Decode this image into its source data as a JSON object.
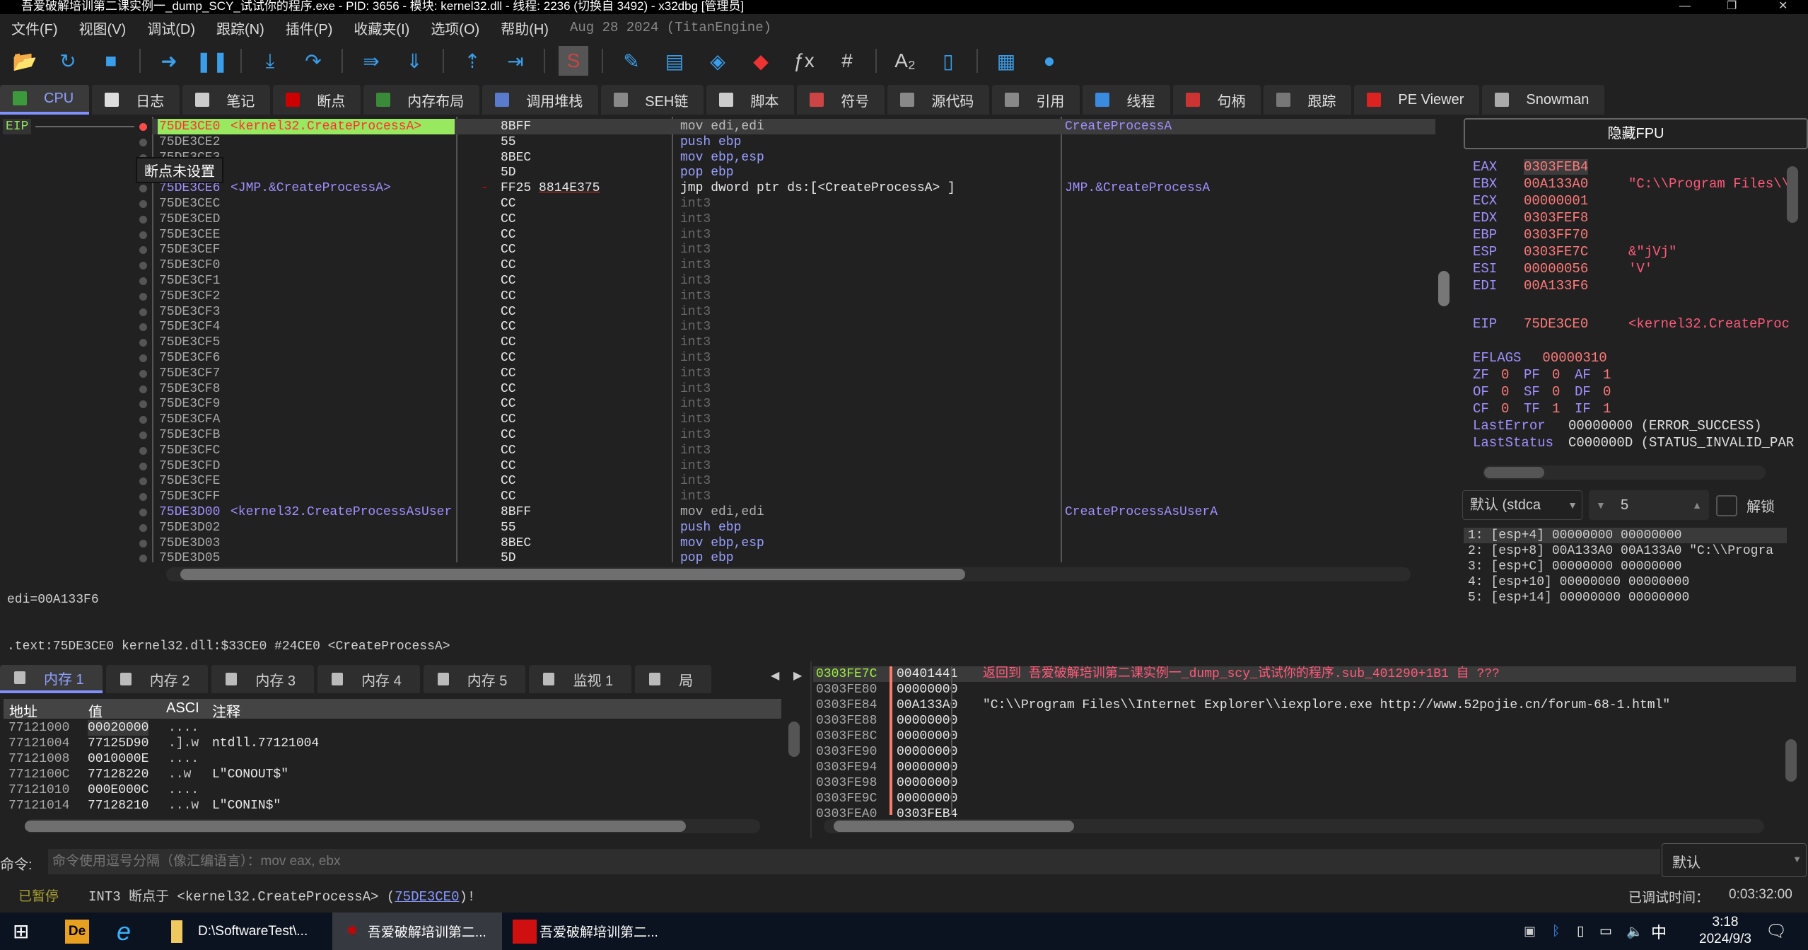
{
  "window": {
    "title": "吾爱破解培训第二课实例一_dump_SCY_试试你的程序.exe - PID: 3656 - 模块: kernel32.dll - 线程: 2236 (切换自 3492) - x32dbg [管理员]",
    "min": "—",
    "max": "❐",
    "close": "✕"
  },
  "menu": {
    "items": [
      "文件(F)",
      "视图(V)",
      "调试(D)",
      "跟踪(N)",
      "插件(P)",
      "收藏夹(I)",
      "选项(O)",
      "帮助(H)"
    ],
    "version": "Aug 28 2024 (TitanEngine)"
  },
  "toolbar": [
    {
      "icon": "open-icon",
      "g": "📂"
    },
    {
      "icon": "restart-icon",
      "g": "↻"
    },
    {
      "icon": "stop-icon",
      "g": "■"
    },
    {
      "sep": true
    },
    {
      "icon": "run-icon",
      "g": "➜"
    },
    {
      "icon": "pause-icon",
      "g": "❚❚"
    },
    {
      "sep": true
    },
    {
      "icon": "step-into-icon",
      "g": "⤓"
    },
    {
      "icon": "step-over-icon",
      "g": "↷"
    },
    {
      "sep": true
    },
    {
      "icon": "trace-into-icon",
      "g": "⇛"
    },
    {
      "icon": "trace-over-icon",
      "g": "⇓"
    },
    {
      "sep": true
    },
    {
      "icon": "execute-till-return-icon",
      "g": "⇡"
    },
    {
      "icon": "run-to-user-code-icon",
      "g": "⇥"
    },
    {
      "sep": true
    },
    {
      "icon": "scylla-icon",
      "g": "S"
    },
    {
      "sep": true
    },
    {
      "icon": "patch-icon",
      "g": "✎"
    },
    {
      "icon": "comments-icon",
      "g": "▤"
    },
    {
      "icon": "labels-icon",
      "g": "◈"
    },
    {
      "icon": "bookmarks-icon",
      "g": "◆"
    },
    {
      "icon": "functions-icon",
      "g": "ƒx"
    },
    {
      "icon": "hash-icon",
      "g": "#"
    },
    {
      "sep": true
    },
    {
      "icon": "strings-icon",
      "g": "A₂"
    },
    {
      "icon": "calls-icon",
      "g": "▯"
    },
    {
      "sep": true
    },
    {
      "icon": "calculator-icon",
      "g": "▦"
    },
    {
      "icon": "globe-icon",
      "g": "●"
    }
  ],
  "tabs": [
    {
      "label": "CPU",
      "color": "#3c9a3c",
      "active": true
    },
    {
      "label": "日志",
      "color": "#ddd"
    },
    {
      "label": "笔记",
      "color": "#ccc"
    },
    {
      "label": "断点",
      "color": "#c00"
    },
    {
      "label": "内存布局",
      "color": "#3a8a3a"
    },
    {
      "label": "调用堆栈",
      "color": "#5a7acc"
    },
    {
      "label": "SEH链",
      "color": "#888"
    },
    {
      "label": "脚本",
      "color": "#ccc"
    },
    {
      "label": "符号",
      "color": "#c44"
    },
    {
      "label": "源代码",
      "color": "#888"
    },
    {
      "label": "引用",
      "color": "#888"
    },
    {
      "label": "线程",
      "color": "#3a8ae0"
    },
    {
      "label": "句柄",
      "color": "#c33"
    },
    {
      "label": "跟踪",
      "color": "#777"
    },
    {
      "label": "PE Viewer",
      "color": "#d22"
    },
    {
      "label": "Snowman",
      "color": "#aaa"
    }
  ],
  "disasm": {
    "eip_label": "EIP",
    "tooltip": "断点未设置",
    "rows": [
      {
        "addr": "75DE3CE0",
        "label": "<kernel32.CreateProcessA>",
        "bytes": "8BFF",
        "ins": "mov edi,edi",
        "cmt": "CreateProcessA",
        "eip": true
      },
      {
        "addr": "75DE3CE2",
        "bytes": "55",
        "ins": "push ebp"
      },
      {
        "addr": "75DE3CE3",
        "bytes": "8BEC",
        "ins": "mov ebp,esp"
      },
      {
        "addr": "75DE3CE5",
        "bytes": "5D",
        "ins": "pop ebp"
      },
      {
        "addr": "75DE3CE6",
        "label": "<JMP.&CreateProcessA>",
        "bytes": "FF25 8814E375",
        "ins": "jmp dword ptr  ds:[<CreateProcessA> ]",
        "cmt": "JMP.&CreateProcessA",
        "jump": true
      },
      {
        "addr": "75DE3CEC",
        "bytes": "CC",
        "ins": "int3"
      },
      {
        "addr": "75DE3CED",
        "bytes": "CC",
        "ins": "int3"
      },
      {
        "addr": "75DE3CEE",
        "bytes": "CC",
        "ins": "int3"
      },
      {
        "addr": "75DE3CEF",
        "bytes": "CC",
        "ins": "int3"
      },
      {
        "addr": "75DE3CF0",
        "bytes": "CC",
        "ins": "int3"
      },
      {
        "addr": "75DE3CF1",
        "bytes": "CC",
        "ins": "int3"
      },
      {
        "addr": "75DE3CF2",
        "bytes": "CC",
        "ins": "int3"
      },
      {
        "addr": "75DE3CF3",
        "bytes": "CC",
        "ins": "int3"
      },
      {
        "addr": "75DE3CF4",
        "bytes": "CC",
        "ins": "int3"
      },
      {
        "addr": "75DE3CF5",
        "bytes": "CC",
        "ins": "int3"
      },
      {
        "addr": "75DE3CF6",
        "bytes": "CC",
        "ins": "int3"
      },
      {
        "addr": "75DE3CF7",
        "bytes": "CC",
        "ins": "int3"
      },
      {
        "addr": "75DE3CF8",
        "bytes": "CC",
        "ins": "int3"
      },
      {
        "addr": "75DE3CF9",
        "bytes": "CC",
        "ins": "int3"
      },
      {
        "addr": "75DE3CFA",
        "bytes": "CC",
        "ins": "int3"
      },
      {
        "addr": "75DE3CFB",
        "bytes": "CC",
        "ins": "int3"
      },
      {
        "addr": "75DE3CFC",
        "bytes": "CC",
        "ins": "int3"
      },
      {
        "addr": "75DE3CFD",
        "bytes": "CC",
        "ins": "int3"
      },
      {
        "addr": "75DE3CFE",
        "bytes": "CC",
        "ins": "int3"
      },
      {
        "addr": "75DE3CFF",
        "bytes": "CC",
        "ins": "int3"
      },
      {
        "addr": "75DE3D00",
        "label": "<kernel32.CreateProcessAsUser",
        "bytes": "8BFF",
        "ins": "mov edi,edi",
        "cmt": "CreateProcessAsUserA"
      },
      {
        "addr": "75DE3D02",
        "bytes": "55",
        "ins": "push ebp"
      },
      {
        "addr": "75DE3D03",
        "bytes": "8BEC",
        "ins": "mov ebp,esp"
      },
      {
        "addr": "75DE3D05",
        "bytes": "5D",
        "ins": "pop ebp"
      }
    ]
  },
  "info": {
    "line1": "edi=00A133F6",
    "line2": ".text:75DE3CE0 kernel32.dll:$33CE0 #24CE0 <CreateProcessA>"
  },
  "registers": {
    "fpu_button": "隐藏FPU",
    "gp": [
      {
        "n": "EAX",
        "v": "0303FEB4",
        "c": ""
      },
      {
        "n": "EBX",
        "v": "00A133A0",
        "c": "\"C:\\\\Program Files\\\\"
      },
      {
        "n": "ECX",
        "v": "00000001",
        "c": ""
      },
      {
        "n": "EDX",
        "v": "0303FEF8",
        "c": ""
      },
      {
        "n": "EBP",
        "v": "0303FF70",
        "c": ""
      },
      {
        "n": "ESP",
        "v": "0303FE7C",
        "c": "&\"jVj\""
      },
      {
        "n": "ESI",
        "v": "00000056",
        "c": "'V'"
      },
      {
        "n": "EDI",
        "v": "00A133F6",
        "c": ""
      }
    ],
    "eip": {
      "n": "EIP",
      "v": "75DE3CE0",
      "c": "<kernel32.CreateProc"
    },
    "eflags": {
      "n": "EFLAGS",
      "v": "00000310"
    },
    "flags": [
      [
        "ZF",
        "0",
        "PF",
        "0",
        "AF",
        "1"
      ],
      [
        "OF",
        "0",
        "SF",
        "0",
        "DF",
        "0"
      ],
      [
        "CF",
        "0",
        "TF",
        "1",
        "IF",
        "1"
      ]
    ],
    "last_error": {
      "n": "LastError",
      "v": "00000000 (ERROR_SUCCESS)"
    },
    "last_status": {
      "n": "LastStatus",
      "v": "C000000D (STATUS_INVALID_PAR"
    }
  },
  "callconv": {
    "convention": "默认 (stdca",
    "count": "5",
    "unlock_label": "解锁",
    "unlocked": false,
    "args": [
      "1: [esp+4] 00000000 00000000",
      "2: [esp+8] 00A133A0 00A133A0 \"C:\\\\Progra",
      "3: [esp+C] 00000000 00000000",
      "4: [esp+10] 00000000 00000000",
      "5: [esp+14] 00000000 00000000"
    ]
  },
  "memtabs": [
    "内存 1",
    "内存 2",
    "内存 3",
    "内存 4",
    "内存 5",
    "监视 1",
    "局"
  ],
  "dump": {
    "headers": [
      "地址",
      "值",
      "ASCI",
      "注释"
    ],
    "rows": [
      [
        "77121000",
        "00020000",
        "....",
        ""
      ],
      [
        "77121004",
        "77125D90",
        ".].w",
        "ntdll.77121004"
      ],
      [
        "77121008",
        "0010000E",
        "....",
        ""
      ],
      [
        "7712100C",
        "77128220",
        "..w",
        "L\"CONOUT$\""
      ],
      [
        "77121010",
        "000E000C",
        "....",
        ""
      ],
      [
        "77121014",
        "77128210",
        "...w",
        "L\"CONIN$\""
      ]
    ]
  },
  "stack": {
    "rows": [
      [
        "0303FE7C",
        "00401441",
        "返回到 吾爱破解培训第二课实例一_dump_scy_试试你的程序.sub_401290+1B1 自 ???"
      ],
      [
        "0303FE80",
        "00000000",
        ""
      ],
      [
        "0303FE84",
        "00A133A0",
        "\"C:\\\\Program Files\\\\Internet Explorer\\\\iexplore.exe http://www.52pojie.cn/forum-68-1.html\""
      ],
      [
        "0303FE88",
        "00000000",
        ""
      ],
      [
        "0303FE8C",
        "00000000",
        ""
      ],
      [
        "0303FE90",
        "00000000",
        ""
      ],
      [
        "0303FE94",
        "00000000",
        ""
      ],
      [
        "0303FE98",
        "00000000",
        ""
      ],
      [
        "0303FE9C",
        "00000000",
        ""
      ],
      [
        "0303FEA0",
        "0303FEB4",
        ""
      ]
    ]
  },
  "command": {
    "label": "命令:",
    "placeholder": "命令使用逗号分隔（像汇编语言）：mov eax, ebx",
    "mode": "默认"
  },
  "status": {
    "state": "已暂停",
    "message_prefix": "INT3 断点于 <kernel32.CreateProcessA> (",
    "address_link": "75DE3CE0",
    "message_suffix": ")!",
    "debug_time_label": "已调试时间：",
    "debug_time": "0:03:32:00"
  },
  "taskbar": {
    "items": [
      "D:\\SoftwareTest\\...",
      "吾爱破解培训第二...",
      "吾爱破解培训第二..."
    ],
    "time": "3:18",
    "date": "2024/9/3",
    "ime": "中"
  }
}
